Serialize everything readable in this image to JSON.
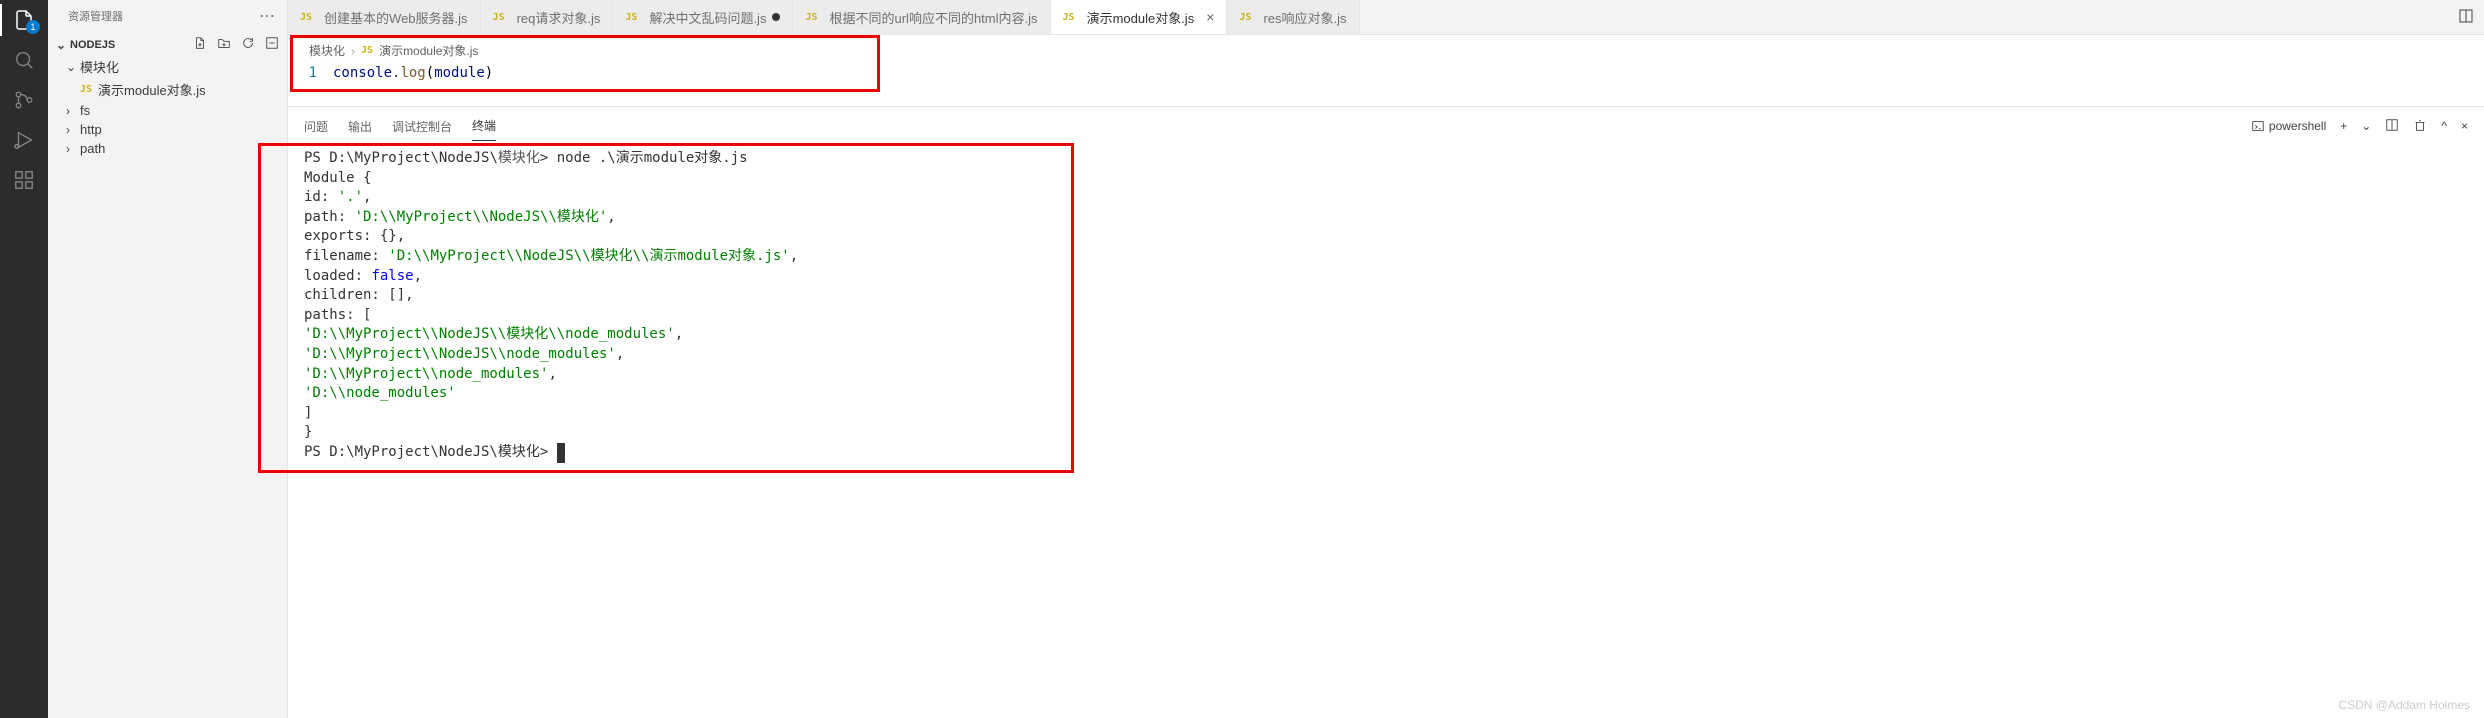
{
  "activityBar": {
    "badgeCount": "1"
  },
  "sidebar": {
    "title": "资源管理器",
    "project": "NODEJS",
    "folderOpen": "模块化",
    "activeFile": "演示module对象.js",
    "folders": [
      "fs",
      "http",
      "path"
    ]
  },
  "tabs": [
    {
      "label": "创建基本的Web服务器.js",
      "active": false,
      "dirty": false
    },
    {
      "label": "req请求对象.js",
      "active": false,
      "dirty": false
    },
    {
      "label": "解决中文乱码问题.js",
      "active": false,
      "dirty": true
    },
    {
      "label": "根据不同的url响应不同的html内容.js",
      "active": false,
      "dirty": false
    },
    {
      "label": "演示module对象.js",
      "active": true,
      "dirty": false
    },
    {
      "label": "res响应对象.js",
      "active": false,
      "dirty": false
    }
  ],
  "breadcrumb": {
    "folder": "模块化",
    "file": "演示module对象.js"
  },
  "editor": {
    "lineNo": "1",
    "obj1": "console",
    "dot": ".",
    "fn": "log",
    "arg": "module"
  },
  "panel": {
    "tabs": [
      "问题",
      "输出",
      "调试控制台",
      "终端"
    ],
    "activeTab": "终端",
    "shell": "powershell"
  },
  "terminal": {
    "promptPrefix": "PS ",
    "cwd": "D:\\MyProject\\NodeJS\\",
    "cwdCn": "模块化",
    "cmd": "> node .\\演示module对象.js",
    "out_header": "Module {",
    "out_id_k": "  id: ",
    "out_id_v": "'.'",
    "out_path_k": "  path: ",
    "out_path_v": "'D:\\\\MyProject\\\\NodeJS\\\\模块化'",
    "out_exports": "  exports: {},",
    "out_filename_k": "  filename: ",
    "out_filename_v": "'D:\\\\MyProject\\\\NodeJS\\\\模块化\\\\演示module对象.js'",
    "out_loaded_k": "  loaded: ",
    "out_loaded_v": "false",
    "out_children": "  children: [],",
    "out_paths_open": "  paths: [",
    "out_p1": "    'D:\\\\MyProject\\\\NodeJS\\\\模块化\\\\node_modules'",
    "out_p2": "    'D:\\\\MyProject\\\\NodeJS\\\\node_modules'",
    "out_p3": "    'D:\\\\MyProject\\\\node_modules'",
    "out_p4": "    'D:\\\\node_modules'",
    "out_paths_close": "  ]",
    "out_close": "}",
    "prompt2": "PS D:\\MyProject\\NodeJS\\模块化> "
  },
  "watermark": "CSDN @Addam Holmes"
}
